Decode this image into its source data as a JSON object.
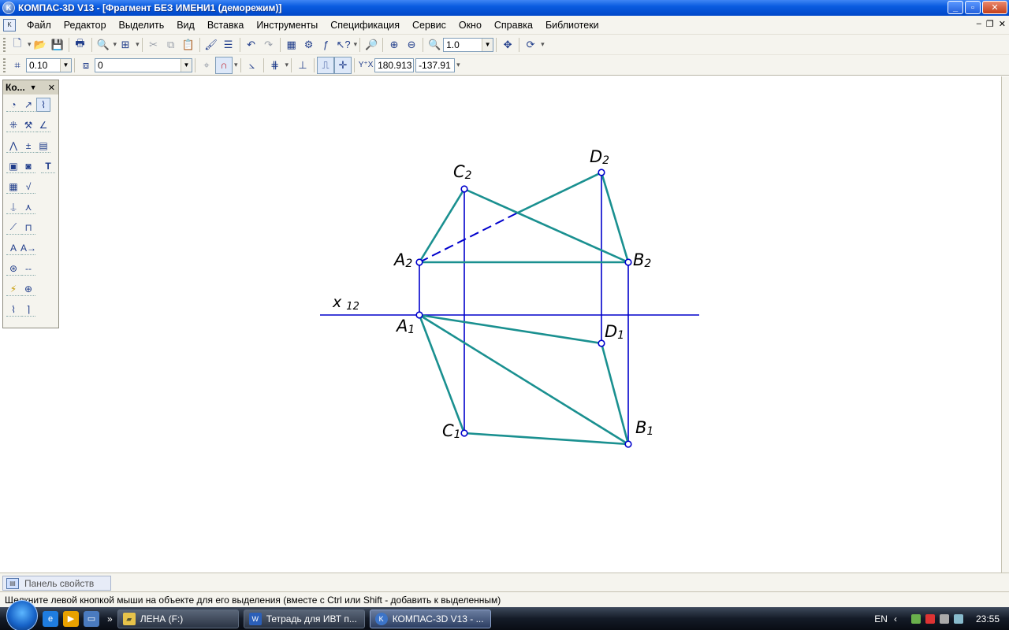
{
  "window": {
    "title": "КОМПАС-3D V13 - [Фрагмент БЕЗ ИМЕНИ1 (деморежим)]",
    "app_icon": "kompas-logo-icon"
  },
  "menu": {
    "items": [
      "Файл",
      "Редактор",
      "Выделить",
      "Вид",
      "Вставка",
      "Инструменты",
      "Спецификация",
      "Сервис",
      "Окно",
      "Справка",
      "Библиотеки"
    ]
  },
  "toolbar1": {
    "zoom_value": "1.0"
  },
  "toolbar2": {
    "step_value": "0.10",
    "layer_value": "0",
    "coord_x": "180.913",
    "coord_y": "-137.91"
  },
  "compact_panel": {
    "title": "Ко..."
  },
  "drawing": {
    "axis_label": "x12",
    "points": [
      {
        "id": "A2",
        "letter": "A",
        "sub": "2"
      },
      {
        "id": "B2",
        "letter": "B",
        "sub": "2"
      },
      {
        "id": "C2",
        "letter": "C",
        "sub": "2"
      },
      {
        "id": "D2",
        "letter": "D",
        "sub": "2"
      },
      {
        "id": "A1",
        "letter": "A",
        "sub": "1"
      },
      {
        "id": "B1",
        "letter": "B",
        "sub": "1"
      },
      {
        "id": "C1",
        "letter": "C",
        "sub": "1"
      },
      {
        "id": "D1",
        "letter": "D",
        "sub": "1"
      }
    ],
    "colors": {
      "blue": "#0000cc",
      "teal": "#1a9090"
    }
  },
  "properties_panel": {
    "tab_label": "Панель свойств"
  },
  "status": {
    "hint": "Щелкните левой кнопкой мыши на объекте для его выделения (вместе с Ctrl или Shift - добавить к выделенным)"
  },
  "taskbar": {
    "overflow": "»",
    "buttons": [
      {
        "label": "ЛЕНА (F:)"
      },
      {
        "label": "Тетрадь для ИВТ п..."
      },
      {
        "label": "КОМПАС-3D V13 - ..."
      }
    ],
    "lang": "EN",
    "clock": "23:55"
  }
}
